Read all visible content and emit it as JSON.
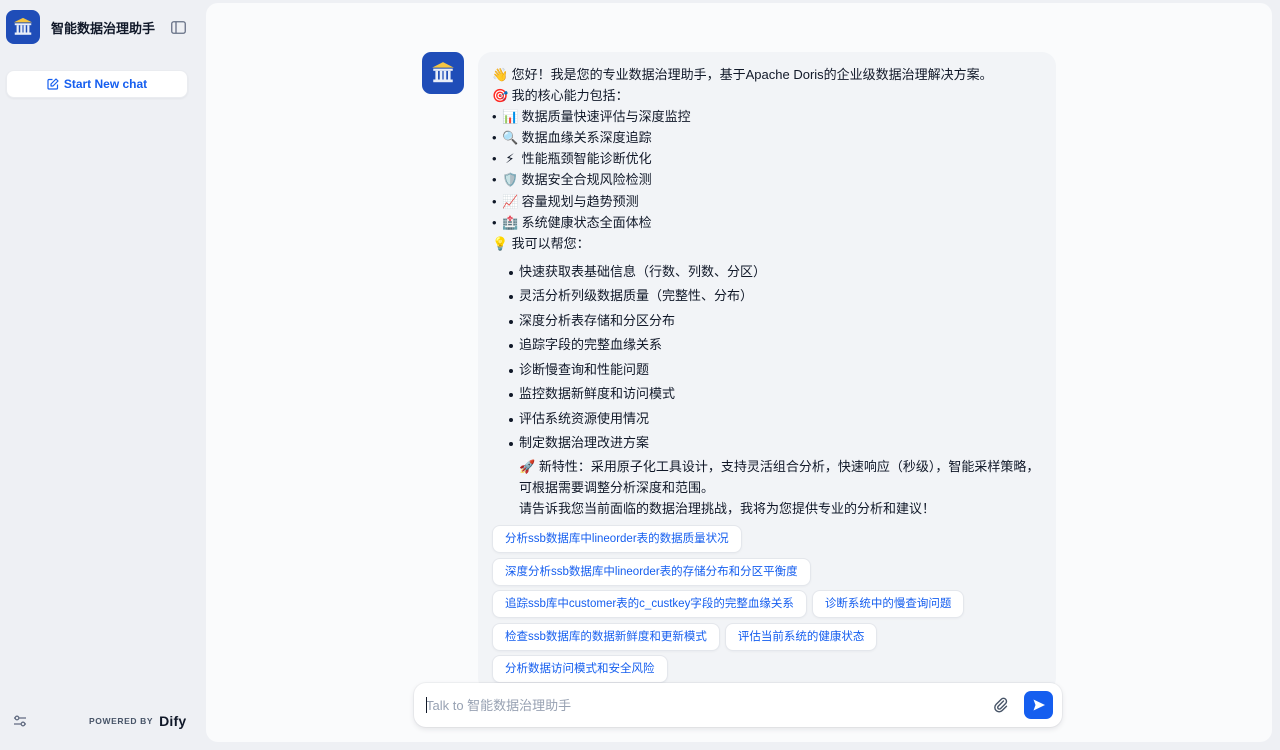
{
  "app": {
    "name": "智能数据治理助手",
    "icon": "museum-icon",
    "accent": "#155eef",
    "icon_bg": "#1f4db8"
  },
  "sidebar": {
    "new_chat_label": "Start New chat",
    "powered_by": "POWERED BY",
    "brand": "Dify"
  },
  "message": {
    "greeting": "您好！我是您的专业数据治理助手，基于Apache Doris的企业级数据治理解决方案。",
    "greeting_emoji": "👋",
    "core_heading": "我的核心能力包括：",
    "core_emoji": "🎯",
    "core_items": [
      {
        "emoji": "📊",
        "text": "数据质量快速评估与深度监控"
      },
      {
        "emoji": "🔍",
        "text": "数据血缘关系深度追踪"
      },
      {
        "emoji": "⚡",
        "text": "性能瓶颈智能诊断优化"
      },
      {
        "emoji": "🛡️",
        "text": "数据安全合规风险检测"
      },
      {
        "emoji": "📈",
        "text": "容量规划与趋势预测"
      },
      {
        "emoji": "🏥",
        "text": "系统健康状态全面体检"
      }
    ],
    "help_heading": "我可以帮您：",
    "help_emoji": "💡",
    "help_items": [
      "快速获取表基础信息（行数、列数、分区）",
      "灵活分析列级数据质量（完整性、分布）",
      "深度分析表存储和分区分布",
      "追踪字段的完整血缘关系",
      "诊断慢查询和性能问题",
      "监控数据新鲜度和访问模式",
      "评估系统资源使用情况",
      "制定数据治理改进方案"
    ],
    "feature_emoji": "🚀",
    "feature_text": "新特性：采用原子化工具设计，支持灵活组合分析，快速响应（秒级），智能采样策略，可根据需要调整分析深度和范围。",
    "closing": "请告诉我您当前面临的数据治理挑战，我将为您提供专业的分析和建议！"
  },
  "suggestions": [
    "分析ssb数据库中lineorder表的数据质量状况",
    "深度分析ssb数据库中lineorder表的存储分布和分区平衡度",
    "追踪ssb库中customer表的c_custkey字段的完整血缘关系",
    "诊断系统中的慢查询问题",
    "检查ssb数据库的数据新鲜度和更新模式",
    "评估当前系统的健康状态",
    "分析数据访问模式和安全风险"
  ],
  "composer": {
    "placeholder": "Talk to 智能数据治理助手",
    "value": ""
  }
}
